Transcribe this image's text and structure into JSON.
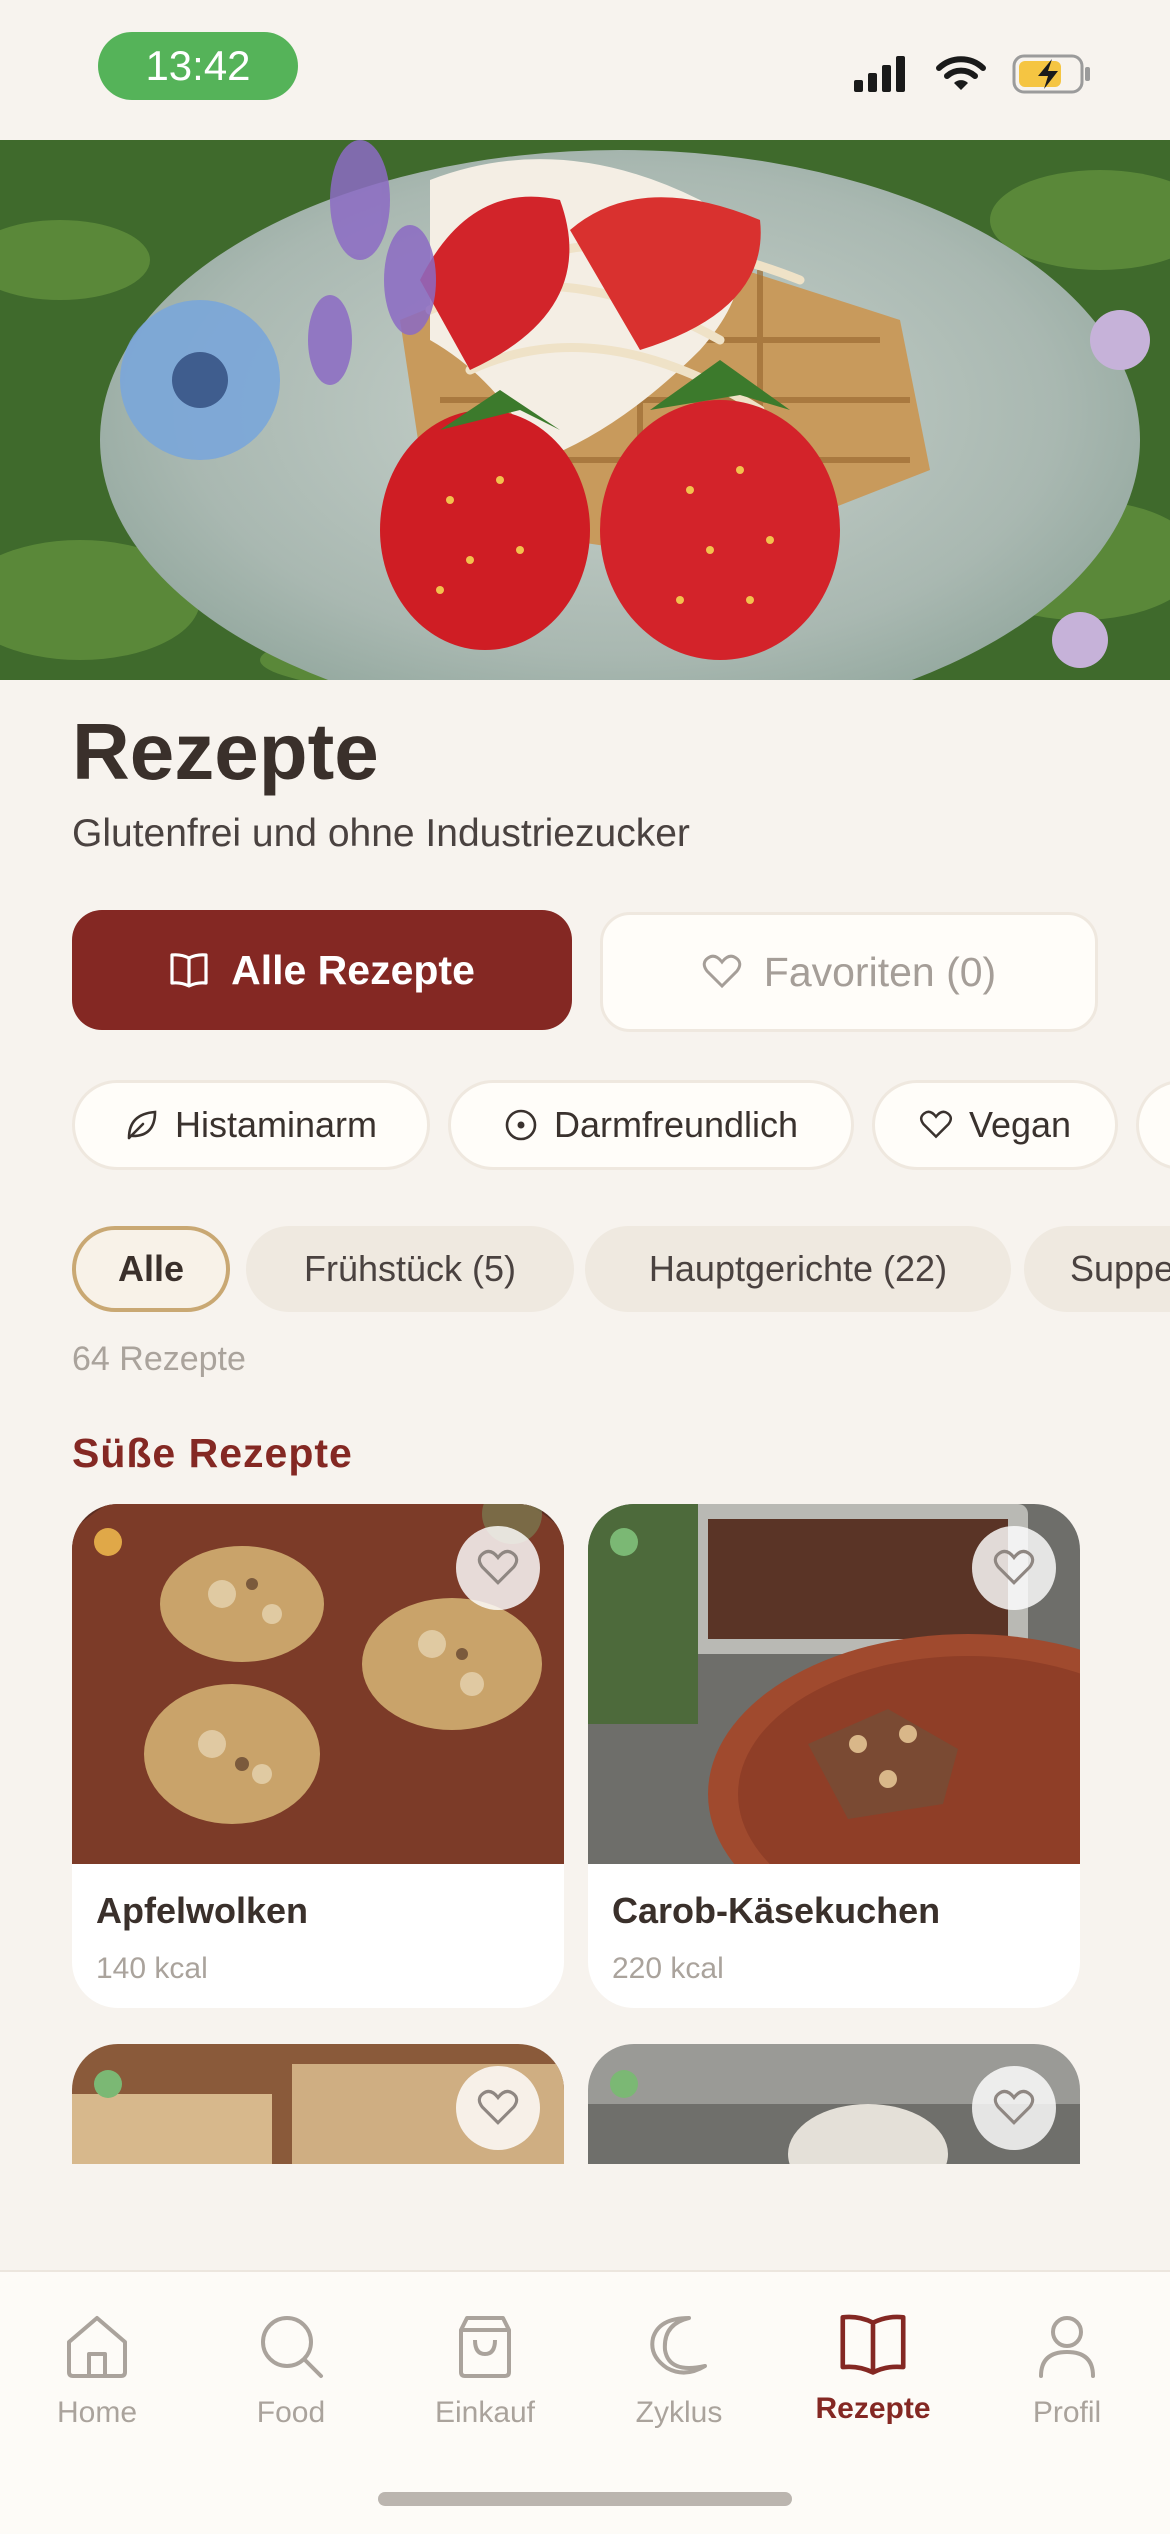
{
  "status_bar": {
    "time": "13:42"
  },
  "header": {
    "title": "Rezepte",
    "subtitle": "Glutenfrei und ohne Industriezucker"
  },
  "view_toggle": {
    "all_label": "Alle Rezepte",
    "favorites_label": "Favoriten (0)"
  },
  "filters": [
    {
      "label": "Histaminarm",
      "icon": "leaf-icon"
    },
    {
      "label": "Darmfreundlich",
      "icon": "circle-dot-icon"
    },
    {
      "label": "Vegan",
      "icon": "heart-icon"
    }
  ],
  "categories": [
    {
      "label": "Alle",
      "active": true
    },
    {
      "label": "Frühstück (5)",
      "active": false
    },
    {
      "label": "Hauptgerichte (22)",
      "active": false
    },
    {
      "label": "Suppe",
      "active": false
    }
  ],
  "recipe_count": "64 Rezepte",
  "section_title": "Süße Rezepte",
  "recipes": [
    {
      "name": "Apfelwolken",
      "kcal": "140 kcal",
      "indicator_color": "#e0a848"
    },
    {
      "name": "Carob-Käsekuchen",
      "kcal": "220 kcal",
      "indicator_color": "#7bb874"
    }
  ],
  "bottom_nav": [
    {
      "label": "Home",
      "icon": "home-icon",
      "active": false
    },
    {
      "label": "Food",
      "icon": "search-icon",
      "active": false
    },
    {
      "label": "Einkauf",
      "icon": "shopping-bag-icon",
      "active": false
    },
    {
      "label": "Zyklus",
      "icon": "moon-icon",
      "active": false
    },
    {
      "label": "Rezepte",
      "icon": "book-icon",
      "active": true
    },
    {
      "label": "Profil",
      "icon": "user-icon",
      "active": false
    }
  ],
  "colors": {
    "accent": "#842823",
    "background": "#f7f3ee",
    "active_chip_border": "#c9a873"
  }
}
